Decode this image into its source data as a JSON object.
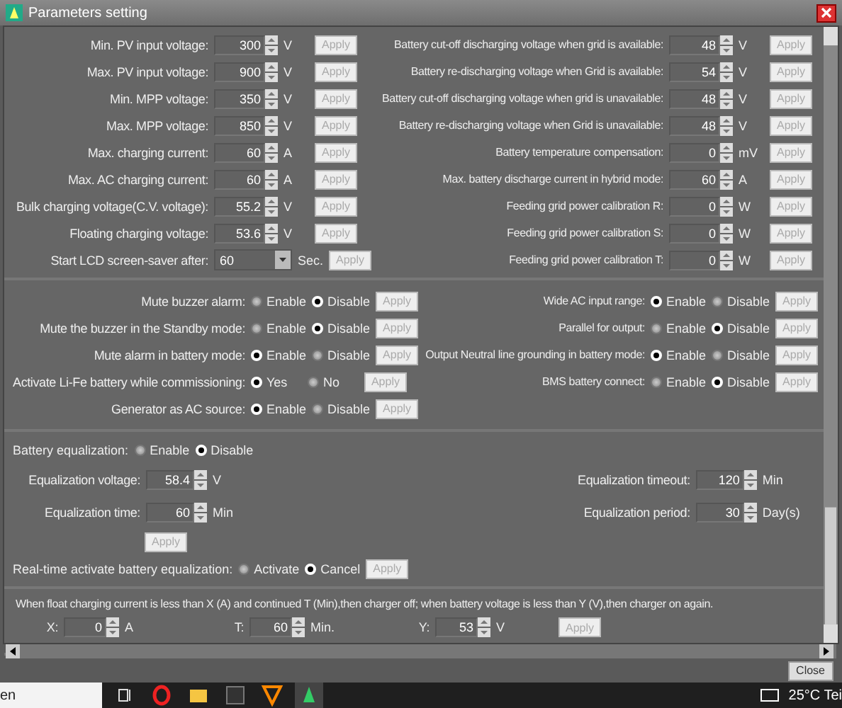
{
  "window": {
    "title": "Parameters setting"
  },
  "left_settings": [
    {
      "kind": "spin",
      "label": "Min. PV input voltage:",
      "value": "300",
      "unit": "V",
      "button": "Apply"
    },
    {
      "kind": "spin",
      "label": "Max. PV input voltage:",
      "value": "900",
      "unit": "V",
      "button": "Apply"
    },
    {
      "kind": "spin",
      "label": "Min. MPP voltage:",
      "value": "350",
      "unit": "V",
      "button": "Apply"
    },
    {
      "kind": "spin",
      "label": "Max. MPP voltage:",
      "value": "850",
      "unit": "V",
      "button": "Apply"
    },
    {
      "kind": "spin",
      "label": "Max. charging current:",
      "value": "60",
      "unit": "A",
      "button": "Apply"
    },
    {
      "kind": "spin",
      "label": "Max. AC charging current:",
      "value": "60",
      "unit": "A",
      "button": "Apply"
    },
    {
      "kind": "spin",
      "label": "Bulk charging voltage(C.V. voltage):",
      "value": "55.2",
      "unit": "V",
      "button": "Apply"
    },
    {
      "kind": "spin",
      "label": "Floating charging voltage:",
      "value": "53.6",
      "unit": "V",
      "button": "Apply"
    },
    {
      "kind": "dropdown",
      "label": "Start LCD screen-saver after:",
      "value": "60",
      "unit": "Sec.",
      "button": "Apply"
    }
  ],
  "right_settings": [
    {
      "kind": "spin",
      "label": "Battery cut-off discharging voltage when grid is available:",
      "value": "48",
      "unit": "V",
      "button": "Apply"
    },
    {
      "kind": "spin",
      "label": "Battery re-discharging voltage when Grid is available:",
      "value": "54",
      "unit": "V",
      "button": "Apply"
    },
    {
      "kind": "spin",
      "label": "Battery cut-off discharging voltage when grid is unavailable:",
      "value": "48",
      "unit": "V",
      "button": "Apply"
    },
    {
      "kind": "spin",
      "label": "Battery re-discharging voltage when Grid is unavailable:",
      "value": "48",
      "unit": "V",
      "button": "Apply"
    },
    {
      "kind": "spin",
      "label": "Battery temperature compensation:",
      "value": "0",
      "unit": "mV",
      "button": "Apply"
    },
    {
      "kind": "spin",
      "label": "Max. battery discharge current in hybrid mode:",
      "value": "60",
      "unit": "A",
      "button": "Apply"
    },
    {
      "kind": "spin",
      "label": "Feeding grid power calibration R:",
      "value": "0",
      "unit": "W",
      "button": "Apply"
    },
    {
      "kind": "spin",
      "label": "Feeding grid power calibration S:",
      "value": "0",
      "unit": "W",
      "button": "Apply"
    },
    {
      "kind": "spin",
      "label": "Feeding grid power calibration T:",
      "value": "0",
      "unit": "W",
      "button": "Apply"
    }
  ],
  "options_left": [
    {
      "label": "Mute buzzer alarm:",
      "choices": [
        {
          "label": "Enable",
          "selected": false
        },
        {
          "label": "Disable",
          "selected": true
        }
      ],
      "button": "Apply"
    },
    {
      "label": "Mute the buzzer in the Standby mode:",
      "choices": [
        {
          "label": "Enable",
          "selected": false
        },
        {
          "label": "Disable",
          "selected": true
        }
      ],
      "button": "Apply"
    },
    {
      "label": "Mute alarm in battery mode:",
      "choices": [
        {
          "label": "Enable",
          "selected": true
        },
        {
          "label": "Disable",
          "selected": false
        }
      ],
      "button": "Apply"
    },
    {
      "label": "Activate Li-Fe battery while commissioning:",
      "choices": [
        {
          "label": "Yes",
          "selected": true
        },
        {
          "label": "No",
          "selected": false
        }
      ],
      "button": "Apply"
    },
    {
      "label": "Generator as AC source:",
      "choices": [
        {
          "label": "Enable",
          "selected": true
        },
        {
          "label": "Disable",
          "selected": false
        }
      ],
      "button": "Apply"
    }
  ],
  "options_right": [
    {
      "label": "Wide AC input range:",
      "choices": [
        {
          "label": "Enable",
          "selected": true
        },
        {
          "label": "Disable",
          "selected": false
        }
      ],
      "button": "Apply"
    },
    {
      "label": "Parallel for output:",
      "choices": [
        {
          "label": "Enable",
          "selected": false
        },
        {
          "label": "Disable",
          "selected": true
        }
      ],
      "button": "Apply"
    },
    {
      "label": "Output Neutral line grounding in battery mode:",
      "choices": [
        {
          "label": "Enable",
          "selected": true
        },
        {
          "label": "Disable",
          "selected": false
        }
      ],
      "button": "Apply"
    },
    {
      "label": "BMS battery connect:",
      "choices": [
        {
          "label": "Enable",
          "selected": false
        },
        {
          "label": "Disable",
          "selected": true
        }
      ],
      "button": "Apply"
    }
  ],
  "equalization": {
    "label": "Battery equalization:",
    "choices": [
      {
        "label": "Enable",
        "selected": false
      },
      {
        "label": "Disable",
        "selected": true
      }
    ],
    "left_fields": [
      {
        "label": "Equalization voltage:",
        "value": "58.4",
        "unit": "V"
      },
      {
        "label": "Equalization time:",
        "value": "60",
        "unit": "Min"
      }
    ],
    "right_fields": [
      {
        "label": "Equalization timeout:",
        "value": "120",
        "unit": "Min"
      },
      {
        "label": "Equalization period:",
        "value": "30",
        "unit": "Day(s)"
      }
    ],
    "button": "Apply",
    "realtime": {
      "label": "Real-time activate battery equalization:",
      "choices": [
        {
          "label": "Activate",
          "selected": false
        },
        {
          "label": "Cancel",
          "selected": true
        }
      ],
      "button": "Apply"
    }
  },
  "float_charge": {
    "description": "When float charging current is less than X (A) and continued T (Min),then charger off; when battery voltage is less than Y (V),then charger on again.",
    "fields": [
      {
        "label": "X:",
        "value": "0",
        "unit": "A"
      },
      {
        "label": "T:",
        "value": "60",
        "unit": "Min."
      },
      {
        "label": "Y:",
        "value": "53",
        "unit": "V"
      }
    ],
    "button": "Apply"
  },
  "close_button": "Close",
  "taskbar": {
    "language": "en",
    "weather": "25°C Tei"
  }
}
